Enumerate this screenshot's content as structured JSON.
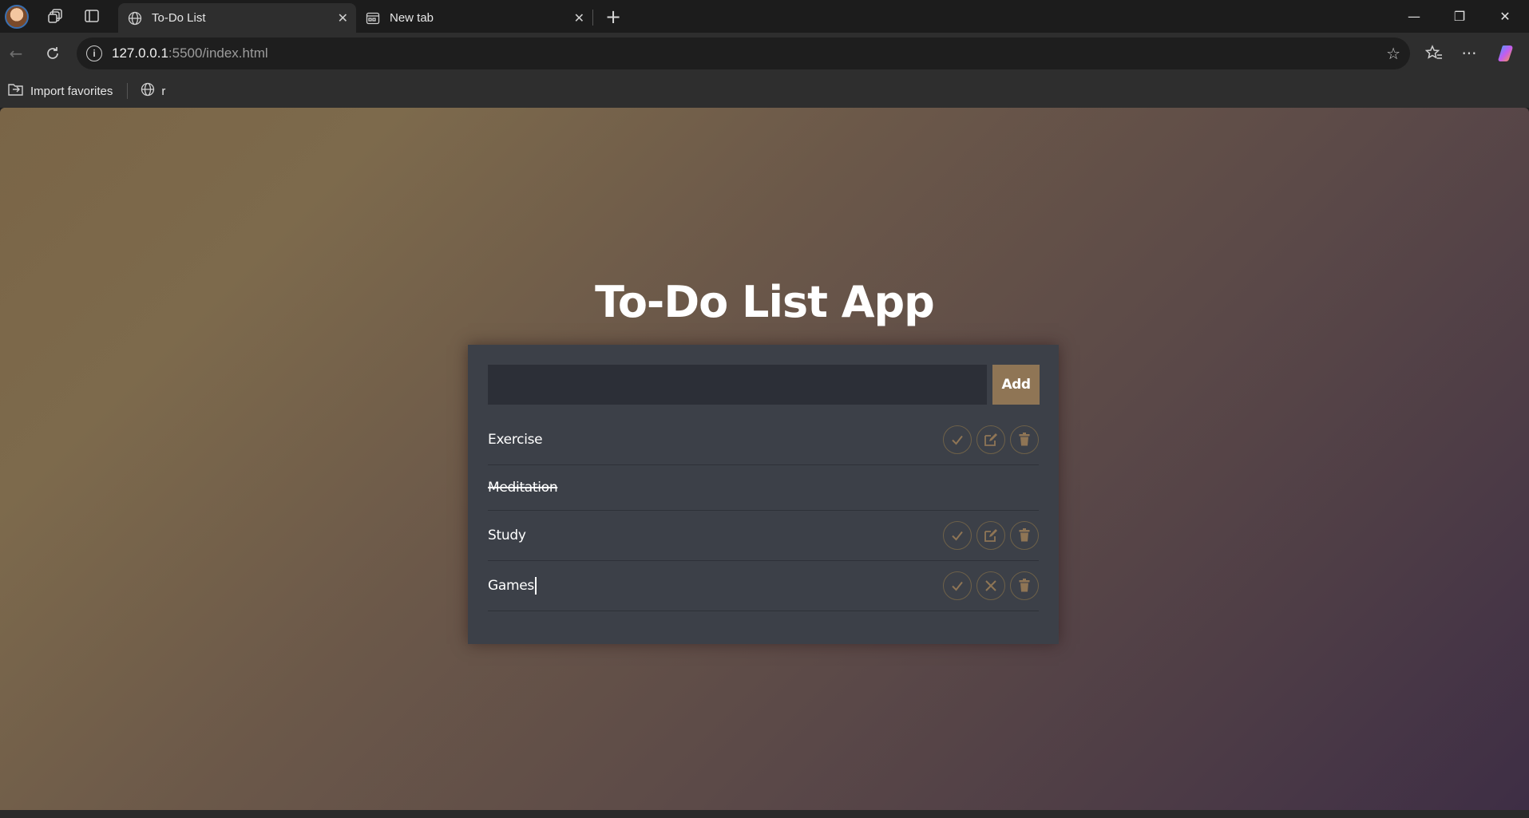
{
  "browser": {
    "tabs": [
      {
        "title": "To-Do List",
        "active": true,
        "icon": "globe-icon"
      },
      {
        "title": "New tab",
        "active": false,
        "icon": "newtab-page-icon"
      }
    ],
    "address": {
      "host": "127.0.0.1",
      "rest": ":5500/index.html"
    },
    "bookmarks": [
      {
        "label": "Import favorites",
        "icon": "import-favorites-icon"
      },
      {
        "label": "r",
        "icon": "globe-icon"
      }
    ]
  },
  "app": {
    "title": "To-Do List App",
    "input": {
      "value": "",
      "placeholder": ""
    },
    "add_label": "Add",
    "accent_color": "#8f7555",
    "tasks": [
      {
        "text": "Exercise",
        "completed": false,
        "editing": false,
        "actions": [
          "check-icon",
          "edit-icon",
          "trash-icon"
        ]
      },
      {
        "text": "Meditation",
        "completed": true,
        "editing": false,
        "actions": []
      },
      {
        "text": "Study",
        "completed": false,
        "editing": false,
        "actions": [
          "check-icon",
          "edit-icon",
          "trash-icon"
        ]
      },
      {
        "text": "Games",
        "completed": false,
        "editing": true,
        "actions": [
          "check-icon",
          "cancel-icon",
          "trash-icon"
        ]
      }
    ]
  }
}
